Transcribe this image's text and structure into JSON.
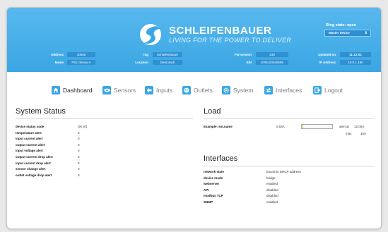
{
  "brand": {
    "name": "SCHLEIFENBAUER",
    "tagline": "LIVING FOR THE POWER TO DELIVER"
  },
  "ring": {
    "status": "Ring state: open",
    "selected": "Master device",
    "arrow_glyph": "⇕"
  },
  "info": {
    "address_label": "Address",
    "address_value": "40555",
    "name_label": "Name",
    "name_value": "PDU Steuw A",
    "tag_label": "Tag",
    "tag_value": "Schleifenbauer",
    "location_label": "Location",
    "location_value": "Demorack",
    "fw_label": "FW version",
    "fw_value": "240",
    "sn_label": "S/N",
    "sn_value": "SVNL00040555",
    "updated_label": "Updated on",
    "updated_value": "11:12:01",
    "ip_label": "IP Address",
    "ip_value": "10.0.1.190"
  },
  "nav": [
    {
      "label": "Dashboard",
      "icon": "home-icon",
      "active": true
    },
    {
      "label": "Sensors",
      "icon": "eye-icon",
      "active": false
    },
    {
      "label": "Inputs",
      "icon": "plug-in-icon",
      "active": false
    },
    {
      "label": "Outlets",
      "icon": "outlet-icon",
      "active": false
    },
    {
      "label": "System",
      "icon": "gear-icon",
      "active": false
    },
    {
      "label": "Interfaces",
      "icon": "arrows-icon",
      "active": false
    },
    {
      "label": "Logout",
      "icon": "logout-icon",
      "active": false
    }
  ],
  "system_status": {
    "title": "System Status",
    "rows": [
      {
        "label": "device status code",
        "value": "OK (0)"
      },
      {
        "label": "temperature alert",
        "value": "0"
      },
      {
        "label": "input current alert",
        "value": "0"
      },
      {
        "label": "output current alert",
        "value": "0"
      },
      {
        "label": "input voltage alert",
        "value": "0"
      },
      {
        "label": "output current drop alert",
        "value": "0"
      },
      {
        "label": "input current drop alert",
        "value": "0"
      },
      {
        "label": "sensor change alert",
        "value": "0"
      },
      {
        "label": "outlet voltage drop alert",
        "value": "0"
      }
    ]
  },
  "load": {
    "title": "Load",
    "label": "Example: ext.name",
    "current": "0.03A",
    "fill_fraction": 0.05,
    "alert_label": "alert at",
    "alert_value": "12.00A",
    "max_label": "max",
    "max_value": "16A"
  },
  "interfaces": {
    "title": "Interfaces",
    "rows": [
      {
        "label": "network state",
        "value": "bound to DHCP address"
      },
      {
        "label": "device mode",
        "value": "bridge"
      },
      {
        "label": "webserver",
        "value": "enabled"
      },
      {
        "label": "API",
        "value": "disabled"
      },
      {
        "label": "modbus TCP",
        "value": "disabled"
      },
      {
        "label": "SNMP",
        "value": "enabled"
      }
    ]
  },
  "colors": {
    "header": "#3aa6e3",
    "accent": "#3aa6e3",
    "field": "#2f90d2"
  }
}
